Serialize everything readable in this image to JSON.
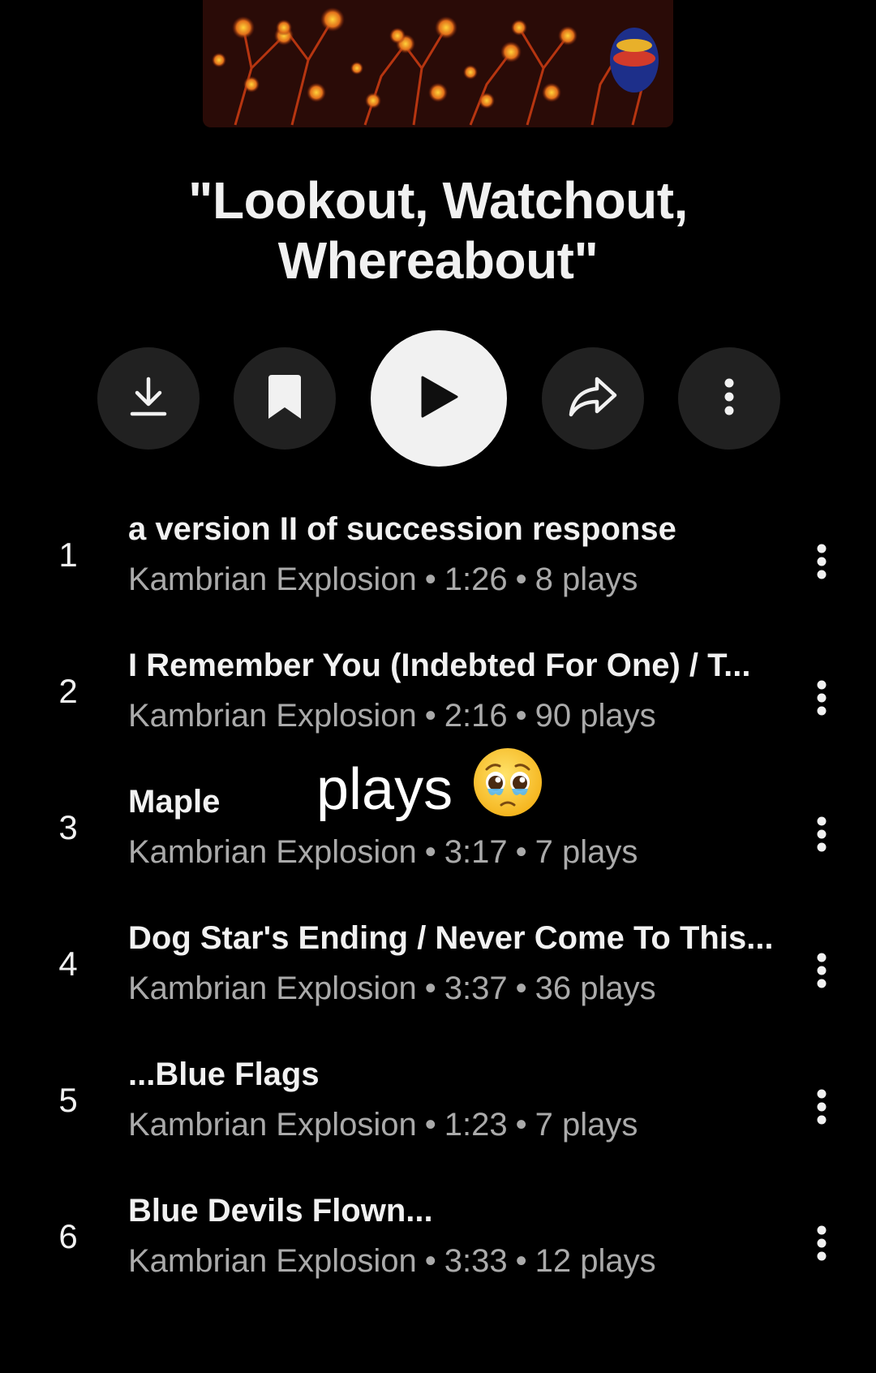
{
  "album": {
    "title_line1": "\"Lookout, Watchout,",
    "title_line2": "Whereabout\""
  },
  "actions": {
    "download": "download-icon",
    "save": "bookmark-icon",
    "play": "play-icon",
    "share": "share-icon",
    "more": "more-vertical-icon"
  },
  "tracks": [
    {
      "number": "1",
      "title": "a version II of succession response",
      "artist": "Kambrian Explosion",
      "duration": "1:26",
      "plays": "8 plays"
    },
    {
      "number": "2",
      "title": "I Remember You (Indebted For One) / T...",
      "artist": "Kambrian Explosion",
      "duration": "2:16",
      "plays": "90 plays"
    },
    {
      "number": "3",
      "title": "Maple",
      "artist": "Kambrian Explosion",
      "duration": "3:17",
      "plays": "7 plays"
    },
    {
      "number": "4",
      "title": "Dog Star's Ending / Never Come To This...",
      "artist": "Kambrian Explosion",
      "duration": "3:37",
      "plays": "36 plays"
    },
    {
      "number": "5",
      "title": "...Blue Flags",
      "artist": "Kambrian Explosion",
      "duration": "1:23",
      "plays": "7 plays"
    },
    {
      "number": "6",
      "title": "Blue Devils Flown...",
      "artist": "Kambrian Explosion",
      "duration": "3:33",
      "plays": "12 plays"
    }
  ],
  "separator": "•",
  "overlay_caption": {
    "text": "plays",
    "emoji": "pleading-face-emoji"
  },
  "colors": {
    "background": "#000000",
    "primary_text": "#f1f1f1",
    "secondary_text": "#aaaaaa",
    "button_bg": "#212121",
    "play_button_bg": "#f1f1f1"
  }
}
